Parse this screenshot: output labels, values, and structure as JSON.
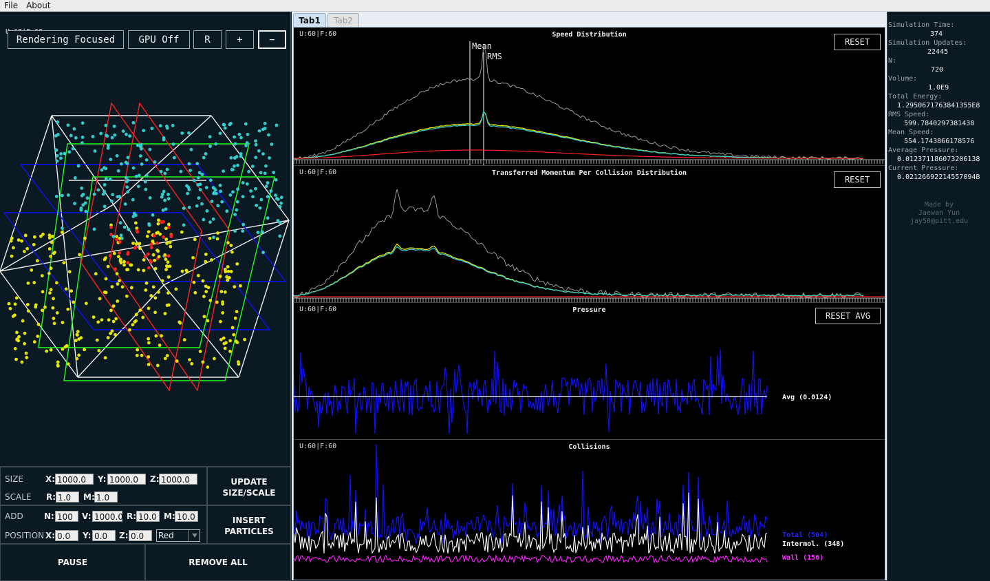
{
  "menu": {
    "file": "File",
    "about": "About"
  },
  "scene": {
    "fps_label": "U:62|F:62",
    "toolbar": {
      "rendering": "Rendering Focused",
      "gpu": "GPU Off",
      "reset": "R",
      "zoom_in": "+",
      "zoom_out": "−"
    }
  },
  "controls": {
    "size": {
      "label": "SIZE",
      "x_label": "X:",
      "x": "1000.0",
      "y_label": "Y:",
      "y": "1000.0",
      "z_label": "Z:",
      "z": "1000.0"
    },
    "scale": {
      "label": "SCALE",
      "r_label": "R:",
      "r": "1.0",
      "m_label": "M:",
      "m": "1.0"
    },
    "update_button": [
      "UPDATE",
      "SIZE/SCALE"
    ],
    "add": {
      "label": "ADD",
      "n_label": "N:",
      "n": "100",
      "v_label": "V:",
      "v": "1000.0",
      "r_label": "R:",
      "r": "10.0",
      "m_label": "M:",
      "m": "10.0"
    },
    "position": {
      "label": "POSITION",
      "x_label": "X:",
      "x": "0.0",
      "y_label": "Y:",
      "y": "0.0",
      "z_label": "Z:",
      "z": "0.0",
      "color": "Red"
    },
    "insert_button": [
      "INSERT",
      "PARTICLES"
    ],
    "pause": "PAUSE",
    "remove_all": "REMOVE ALL"
  },
  "tabs": {
    "tab1": "Tab1",
    "tab2": "Tab2"
  },
  "plots": {
    "speed": {
      "fps": "U:60|F:60",
      "title": "Speed Distribution",
      "button": "RESET",
      "mean_label": "Mean",
      "rms_label": "RMS"
    },
    "momentum": {
      "fps": "U:60|F:60",
      "title": "Transferred Momentum Per Collision Distribution",
      "button": "RESET"
    },
    "pressure": {
      "fps": "U:60|F:60",
      "title": "Pressure",
      "button": "RESET AVG",
      "avg_label": "Avg (0.0124)"
    },
    "collisions": {
      "fps": "U:60|F:60",
      "title": "Collisions",
      "total_label": "Total (504)",
      "intermol_label": "Intermol. (348)",
      "wall_label": "Wall (156)"
    }
  },
  "stats": {
    "sim_time_label": "Simulation Time:",
    "sim_time": "374",
    "sim_updates_label": "Simulation Updates:",
    "sim_updates": "22445",
    "n_label": "N:",
    "n": "720",
    "volume_label": "Volume:",
    "volume": "1.0E9",
    "total_energy_label": "Total Energy:",
    "total_energy": "1.2950671763841355E8",
    "rms_speed_label": "RMS Speed:",
    "rms_speed": "599.7840297381438",
    "mean_speed_label": "Mean Speed:",
    "mean_speed": "554.1743866178576",
    "avg_pressure_label": "Average Pressure:",
    "avg_pressure": "0.012371186073206138",
    "cur_pressure_label": "Current Pressure:",
    "cur_pressure": "0.02126692214557094B"
  },
  "credit": {
    "line1": "Made by",
    "line2": "Jaewan Yun",
    "line3": "jay50@pitt.edu"
  },
  "colors": {
    "cyan": "#33cccc",
    "yellow": "#e6e600",
    "red": "#ff2020",
    "blue": "#1010ff",
    "magenta": "#ff20ff",
    "green": "#20ff20"
  },
  "icons": {
    "dropdown": "chevron-down-icon"
  }
}
